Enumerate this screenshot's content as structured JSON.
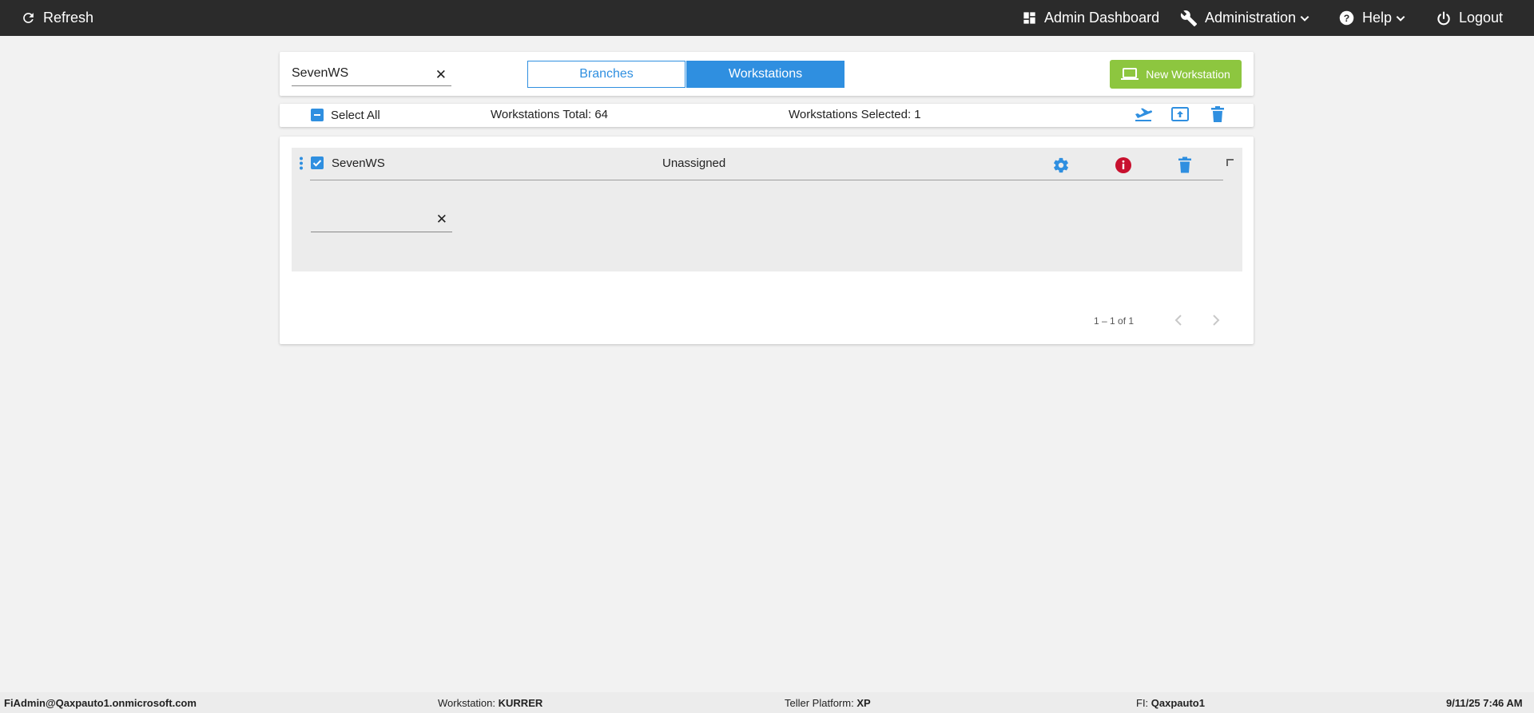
{
  "topbar": {
    "refresh_label": "Refresh",
    "admin_dashboard_label": "Admin Dashboard",
    "administration_label": "Administration",
    "help_label": "Help",
    "logout_label": "Logout"
  },
  "toolbar": {
    "search_value": "SevenWS",
    "tab_branches": "Branches",
    "tab_workstations": "Workstations",
    "active_tab": "Workstations",
    "new_workstation_label": "New Workstation"
  },
  "summary": {
    "select_all_label": "Select All",
    "total_text": "Workstations Total: 64",
    "selected_text": "Workstations Selected: 1"
  },
  "workstations": [
    {
      "name": "SevenWS",
      "branch": "Unassigned",
      "checked": true,
      "input_value": ""
    }
  ],
  "pagination": {
    "range_text": "1 – 1 of 1"
  },
  "footer": {
    "user": "FiAdmin@Qaxpauto1.onmicrosoft.com",
    "workstation_label": "Workstation:",
    "workstation_value": "KURRER",
    "platform_label": "Teller Platform:",
    "platform_value": "XP",
    "fi_label": "FI:",
    "fi_value": "Qaxpauto1",
    "datetime": "9/11/25 7:46 AM"
  },
  "colors": {
    "accent_blue": "#2f8fe0",
    "new_button_green": "#8dc63f",
    "error_red": "#c8102e",
    "topbar_bg": "#2b2b2b"
  }
}
